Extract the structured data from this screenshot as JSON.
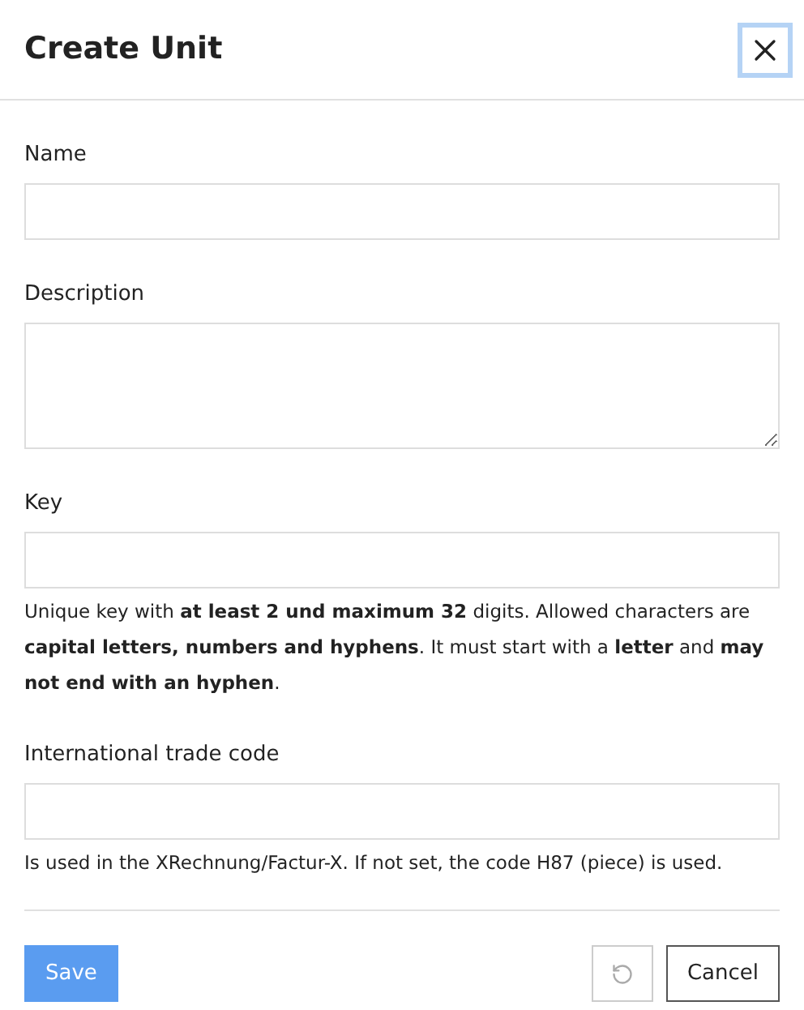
{
  "dialog": {
    "title": "Create Unit"
  },
  "fields": [
    {
      "kind": "input",
      "label": "Name"
    },
    {
      "kind": "textarea",
      "label": "Description"
    },
    {
      "kind": "input",
      "label": "Key",
      "hint": "Unique key with **at least 2 und maximum 32** digits. Allowed characters are **capital letters, numbers and hyphens**. It must start with a **letter** and **may not end with an hyphen**."
    },
    {
      "kind": "input",
      "label": "International trade code",
      "hint": "Is used in the XRechnung/Factur-X. If not set, the code H87 (piece) is used."
    }
  ],
  "footer": {
    "save": "Save",
    "reset": {
      "disabled": true
    },
    "cancel": "Cancel"
  }
}
